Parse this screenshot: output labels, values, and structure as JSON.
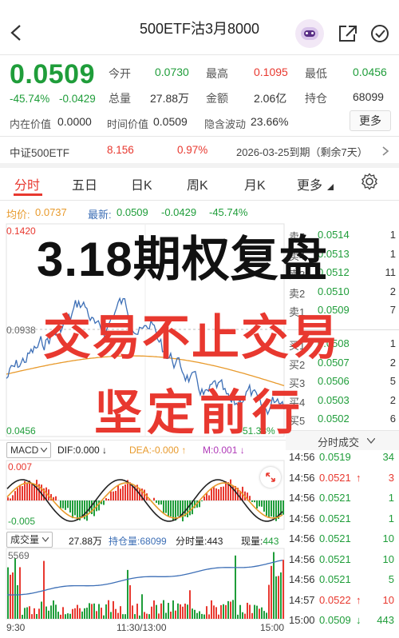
{
  "header": {
    "title": "500ETF沽3月8000"
  },
  "quote": {
    "last": "0.0509",
    "change_pct": "-45.74%",
    "change": "-0.0429",
    "open_label": "今开",
    "open": "0.0730",
    "high_label": "最高",
    "high": "0.1095",
    "low_label": "最低",
    "low": "0.0456",
    "volume_label": "总量",
    "volume": "27.88万",
    "amount_label": "金额",
    "amount": "2.06亿",
    "oi_label": "持仓",
    "oi": "68099",
    "intrinsic_label": "内在价值",
    "intrinsic": "0.0000",
    "time_value_label": "时间价值",
    "time_value": "0.0509",
    "iv_label": "隐含波动",
    "iv": "23.66%",
    "more_label": "更多"
  },
  "underlying": {
    "name": "中证500ETF",
    "price": "8.156",
    "change_pct": "0.97%",
    "expiry": "2026-03-25到期（剩余7天）"
  },
  "tabs": [
    {
      "label": "分时"
    },
    {
      "label": "五日"
    },
    {
      "label": "日K"
    },
    {
      "label": "周K"
    },
    {
      "label": "月K"
    },
    {
      "label": "更多"
    }
  ],
  "intraday": {
    "avg_label": "均价:",
    "avg": "0.0737",
    "latest_label": "最新:",
    "latest": "0.0509",
    "chg": "-0.0429",
    "chg_pct": "-45.74%",
    "y_top": "0.1420",
    "y_mid": "0.0938",
    "y_bottom": "0.0456",
    "right_pct": "-51.38%"
  },
  "order_book": {
    "asks": [
      {
        "label": "卖5",
        "price": "0.0514",
        "qty": "1"
      },
      {
        "label": "卖4",
        "price": "0.0513",
        "qty": "1"
      },
      {
        "label": "卖3",
        "price": "0.0512",
        "qty": "11"
      },
      {
        "label": "卖2",
        "price": "0.0510",
        "qty": "2"
      },
      {
        "label": "卖1",
        "price": "0.0509",
        "qty": "7"
      }
    ],
    "bids": [
      {
        "label": "买1",
        "price": "0.0508",
        "qty": "1"
      },
      {
        "label": "买2",
        "price": "0.0507",
        "qty": "2"
      },
      {
        "label": "买3",
        "price": "0.0506",
        "qty": "5"
      },
      {
        "label": "买4",
        "price": "0.0503",
        "qty": "2"
      },
      {
        "label": "买5",
        "price": "0.0502",
        "qty": "6"
      }
    ]
  },
  "macd": {
    "label": "MACD",
    "dif_label": "DIF:",
    "dif": "0.000",
    "dea_label": "DEA:",
    "dea": "-0.000",
    "m_label": "M:",
    "m": "0.001",
    "y_top": "0.007",
    "y_bottom": "-0.005"
  },
  "volume_panel": {
    "label": "成交量",
    "total": "27.88万",
    "oi_label": "持仓量:",
    "oi": "68099",
    "min_vol_label": "分时量:",
    "min_vol": "443",
    "cur_vol_label": "现量:",
    "cur_vol": "443",
    "y_top": "5569"
  },
  "time_axis": {
    "start": "9:30",
    "mid": "11:30/13:00",
    "end": "15:00"
  },
  "deals": {
    "title": "分时成交",
    "rows": [
      {
        "time": "14:56",
        "price": "0.0519",
        "qty": "34",
        "dir": ""
      },
      {
        "time": "14:56",
        "price": "0.0521",
        "qty": "3",
        "dir": "↑"
      },
      {
        "time": "14:56",
        "price": "0.0521",
        "qty": "1",
        "dir": ""
      },
      {
        "time": "14:56",
        "price": "0.0521",
        "qty": "1",
        "dir": ""
      },
      {
        "time": "14:56",
        "price": "0.0521",
        "qty": "10",
        "dir": ""
      },
      {
        "time": "14:56",
        "price": "0.0521",
        "qty": "10",
        "dir": ""
      },
      {
        "time": "14:56",
        "price": "0.0521",
        "qty": "5",
        "dir": ""
      },
      {
        "time": "14:57",
        "price": "0.0522",
        "qty": "10",
        "dir": "↑"
      },
      {
        "time": "15:00",
        "price": "0.0509",
        "qty": "443",
        "dir": "↓"
      }
    ]
  },
  "overlay": {
    "line1": "3.18期权复盘",
    "line2": "交易不止交易",
    "line3": "坚定前行"
  },
  "colors": {
    "up": "#e8382f",
    "down": "#1f9d3a",
    "price_line": "#3d6fb6",
    "avg_line": "#e89a2c"
  }
}
